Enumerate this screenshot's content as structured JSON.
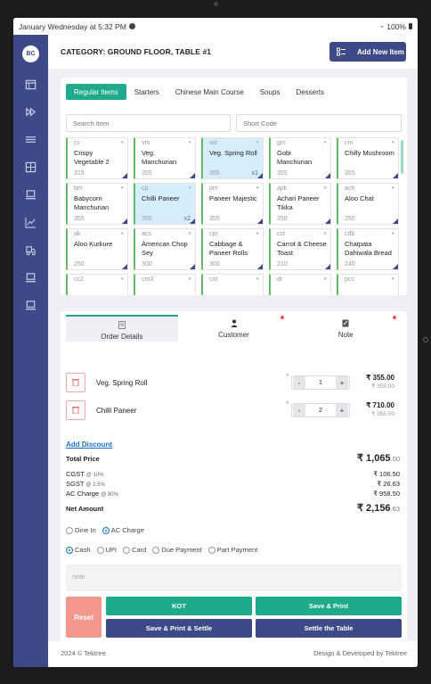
{
  "status_bar": {
    "datetime": "January Wednesday at 5:32 PM",
    "battery": "100%"
  },
  "sidebar": {
    "logo": "BC",
    "icons": [
      "calendar-icon",
      "fast-forward-icon",
      "sliders-icon",
      "table-icon",
      "laptop-icon",
      "chart-icon",
      "delivery-icon",
      "laptop-icon",
      "laptop-icon"
    ]
  },
  "header": {
    "title": "CATEGORY: GROUND FLOOR, TABLE #1",
    "add_button": "Add New Item"
  },
  "menu": {
    "tabs": [
      "Regular Items",
      "Starters",
      "Chinese Main Course",
      "Soups",
      "Desserts"
    ],
    "search_placeholder": "Search Item",
    "shortcode_placeholder": "Short Code",
    "items": [
      {
        "code": "cv",
        "name": "Crispy Vegetable 2",
        "price": "315",
        "qty": "",
        "selected": false
      },
      {
        "code": "vm",
        "name": "Veg. Manchurian",
        "price": "355",
        "qty": "",
        "selected": false
      },
      {
        "code": "vsr",
        "name": "Veg. Spring Roll",
        "price": "355",
        "qty": "x1",
        "selected": true
      },
      {
        "code": "gm",
        "name": "Gobi Manchurian",
        "price": "355",
        "qty": "",
        "selected": false
      },
      {
        "code": "cm",
        "name": "Chilly Mushroom",
        "price": "355",
        "qty": "",
        "selected": false
      },
      {
        "code": "bm",
        "name": "Babycorn Manchurian",
        "price": "355",
        "qty": "",
        "selected": false
      },
      {
        "code": "cp",
        "name": "Chilli Paneer",
        "price": "355",
        "qty": "x2",
        "selected": true
      },
      {
        "code": "pm",
        "name": "Paneer Majestic",
        "price": "355",
        "qty": "",
        "selected": false
      },
      {
        "code": "apk",
        "name": "Achari Paneer Tikka",
        "price": "250",
        "qty": "",
        "selected": false
      },
      {
        "code": "ach",
        "name": "Aloo Chat",
        "price": "250",
        "qty": "",
        "selected": false
      },
      {
        "code": "ak",
        "name": "Aloo Kurkure",
        "price": "250",
        "qty": "",
        "selected": false
      },
      {
        "code": "acs",
        "name": "American Chop Sey",
        "price": "300",
        "qty": "",
        "selected": false
      },
      {
        "code": "cpr",
        "name": "Cabbage & Paneer Rolls",
        "price": "300",
        "qty": "",
        "selected": false
      },
      {
        "code": "cct",
        "name": "Carrot & Cheese Toast",
        "price": "210",
        "qty": "",
        "selected": false
      },
      {
        "code": "cdb",
        "name": "Chatpata Dahiwala Bread",
        "price": "240",
        "qty": "",
        "selected": false
      },
      {
        "code": "cc2",
        "name": "",
        "price": "",
        "qty": "",
        "selected": false
      },
      {
        "code": "cm3",
        "name": "",
        "price": "",
        "qty": "",
        "selected": false
      },
      {
        "code": "cot",
        "name": "",
        "price": "",
        "qty": "",
        "selected": false
      },
      {
        "code": "dr",
        "name": "",
        "price": "",
        "qty": "",
        "selected": false
      },
      {
        "code": "pcs",
        "name": "",
        "price": "",
        "qty": "",
        "selected": false
      }
    ]
  },
  "order": {
    "tabs": [
      "Order Details",
      "Customer",
      "Note"
    ],
    "lines": [
      {
        "name": "Veg. Spring Roll",
        "qty": "1",
        "total": "₹ 355.00",
        "unit": "₹ 355.00"
      },
      {
        "name": "Chilli Paneer",
        "qty": "2",
        "total": "₹ 710.00",
        "unit": "₹ 355.00"
      }
    ],
    "add_discount": "Add Discount",
    "total_label": "Total Price",
    "total_main": "₹ 1,065",
    "total_dec": ".00",
    "cgst_label": "CGST",
    "cgst_rate": "@ 10%",
    "cgst_value": "₹ 106.50",
    "sgst_label": "SGST",
    "sgst_rate": "@ 2.5%",
    "sgst_value": "₹ 26.63",
    "ac_label": "AC Charge",
    "ac_rate": "@ 90%",
    "ac_value": "₹ 958.50",
    "net_label": "Net Amount",
    "net_main": "₹ 2,156",
    "net_dec": ".63",
    "dining": [
      "Dine In",
      "AC Charge"
    ],
    "payments": [
      "Cash",
      "UPI",
      "Card",
      "Due Payment",
      "Part Payment"
    ],
    "note_placeholder": "note",
    "buttons": {
      "reset": "Reset",
      "kot": "KOT",
      "save_print": "Save & Print",
      "save_print_settle": "Save & Print & Settle",
      "settle": "Settle the Table"
    }
  },
  "footer": {
    "left": "2024 © Tektree.",
    "right": "Design & Developed by Tektree"
  }
}
